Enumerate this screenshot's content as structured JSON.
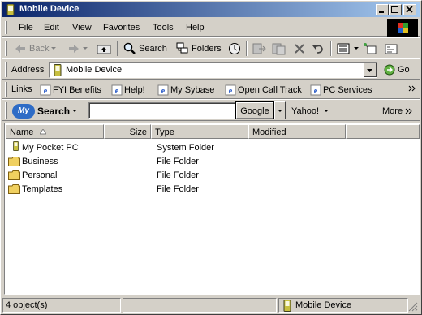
{
  "window": {
    "title": "Mobile Device"
  },
  "menu": {
    "items": [
      "File",
      "Edit",
      "View",
      "Favorites",
      "Tools",
      "Help"
    ]
  },
  "toolbar": {
    "back": "Back",
    "search": "Search",
    "folders": "Folders"
  },
  "address": {
    "label": "Address",
    "value": "Mobile Device",
    "go": "Go"
  },
  "links": {
    "label": "Links",
    "items": [
      "FYI Benefits",
      "Help!",
      "My Sybase",
      "Open Call Track",
      "PC Services"
    ]
  },
  "search_bar": {
    "brand": "MySearch",
    "input_value": "",
    "google": "Google",
    "yahoo": "Yahoo!",
    "more": "More"
  },
  "columns": [
    "Name",
    "Size",
    "Type",
    "Modified"
  ],
  "files": [
    {
      "name": "My Pocket PC",
      "size": "",
      "type": "System Folder",
      "modified": ""
    },
    {
      "name": "Business",
      "size": "",
      "type": "File Folder",
      "modified": ""
    },
    {
      "name": "Personal",
      "size": "",
      "type": "File Folder",
      "modified": ""
    },
    {
      "name": "Templates",
      "size": "",
      "type": "File Folder",
      "modified": ""
    }
  ],
  "status": {
    "count": "4 object(s)",
    "location": "Mobile Device"
  },
  "colors": {
    "title_start": "#0a246a",
    "title_end": "#a6caf0",
    "face": "#d4d0c8",
    "folder": "#f0d060",
    "search_blue": "#2e6cc6"
  }
}
